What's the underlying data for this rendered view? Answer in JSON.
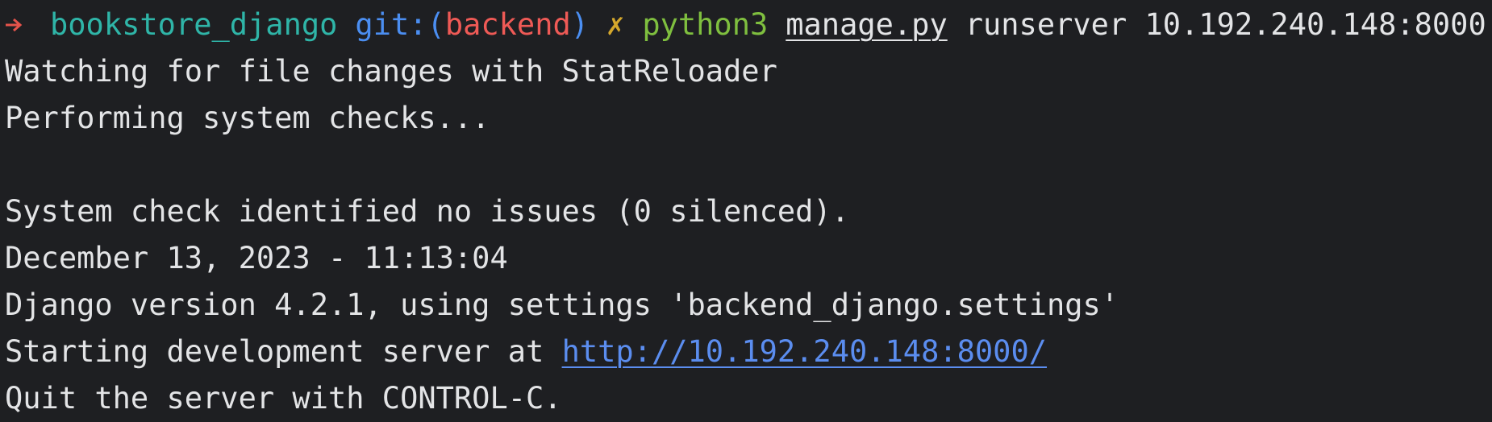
{
  "prompt": {
    "directory": "bookstore_django",
    "git_keyword": "git:",
    "paren_open": "(",
    "branch": "backend",
    "paren_close": ")",
    "dirty_marker": "✗",
    "command": "python3",
    "arg_file": "manage.py",
    "arg_rest": "runserver 10.192.240.148:8000",
    "arrow_icon": "arrow-right-icon"
  },
  "output": {
    "line1": "Watching for file changes with StatReloader",
    "line2": "Performing system checks...",
    "line3": "",
    "line4": "System check identified no issues (0 silenced).",
    "line5": "December 13, 2023 - 11:13:04",
    "line6": "Django version 4.2.1, using settings 'backend_django.settings'",
    "line7_prefix": "Starting development server at ",
    "line7_link": "http://10.192.240.148:8000/",
    "line8": "Quit the server with CONTROL-C."
  },
  "colors": {
    "background": "#1e1f22",
    "text": "#e3e4e6",
    "arrow": "#e5534b",
    "directory": "#2fb5a8",
    "git": "#4b8ef1",
    "branch": "#ef5a56",
    "dirty": "#d4a72c",
    "command": "#7fbf3f",
    "link": "#5b8def"
  }
}
